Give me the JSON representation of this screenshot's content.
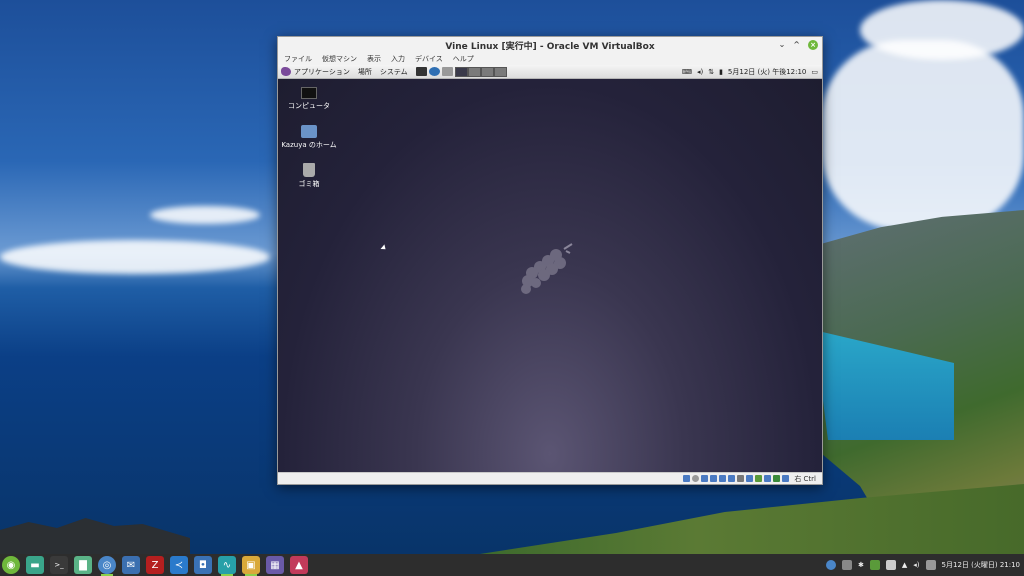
{
  "window": {
    "title": "Vine Linux [実行中] - Oracle VM VirtualBox",
    "menu": [
      "ファイル",
      "仮想マシン",
      "表示",
      "入力",
      "デバイス",
      "ヘルプ"
    ],
    "controls": {
      "minimize": "⌄",
      "maximize": "^"
    }
  },
  "guest_panel": {
    "applications": "アプリケーション",
    "places": "場所",
    "system": "システム",
    "clock": "5月12日 (火) 午後12:10"
  },
  "guest_desktop": {
    "icons": [
      {
        "label": "コンピュータ",
        "icon": "monitor-icon"
      },
      {
        "label": "Kazuya のホーム",
        "icon": "home-folder-icon"
      },
      {
        "label": "ゴミ箱",
        "icon": "trash-icon"
      }
    ]
  },
  "statusbar": {
    "host_key": "右 Ctrl"
  },
  "taskbar": {
    "clock": "5月12日 (火曜日) 21:10",
    "apps": [
      {
        "name": "mint-menu-icon",
        "color": "#6fb83b",
        "glyph": "◉"
      },
      {
        "name": "show-desktop-icon",
        "color": "#3aa58a",
        "glyph": "▬"
      },
      {
        "name": "terminal-icon",
        "color": "#3a3a3a",
        "glyph": ">_"
      },
      {
        "name": "files-icon",
        "color": "#5ab387",
        "glyph": "▇"
      },
      {
        "name": "chromium-icon",
        "color": "#4a86c8",
        "glyph": "◎"
      },
      {
        "name": "mail-icon",
        "color": "#3b6fb0",
        "glyph": "✉"
      },
      {
        "name": "filezilla-icon",
        "color": "#b51f1f",
        "glyph": "Z"
      },
      {
        "name": "vscode-icon",
        "color": "#2a7acb",
        "glyph": "≺"
      },
      {
        "name": "screenshot-icon",
        "color": "#3a72b5",
        "glyph": "◘"
      },
      {
        "name": "system-monitor-icon",
        "color": "#27a0a8",
        "glyph": "∿"
      },
      {
        "name": "virtualbox-icon",
        "color": "#d9a93a",
        "glyph": "▣"
      },
      {
        "name": "app-purple-icon",
        "color": "#6a5aa8",
        "glyph": "▦"
      },
      {
        "name": "image-viewer-icon",
        "color": "#c23a5a",
        "glyph": "▲"
      }
    ]
  }
}
